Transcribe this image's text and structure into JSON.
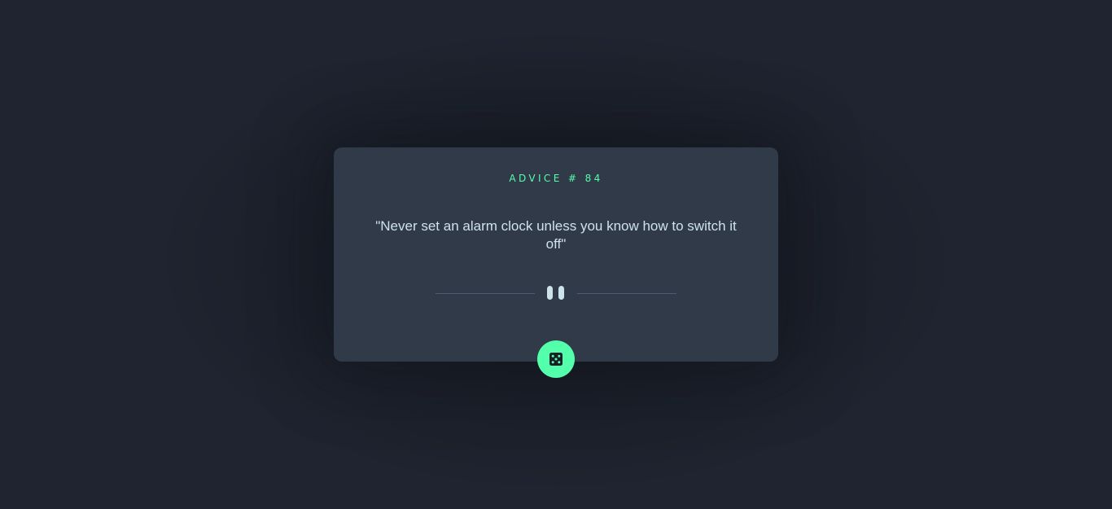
{
  "advice": {
    "heading": "ADVICE # 84",
    "text": "\"Never set an alarm clock unless you know how to switch it off\""
  },
  "divider": {
    "icon": "pause-icon"
  },
  "button": {
    "icon": "dice-icon",
    "aria_label": "Generate new advice"
  },
  "colors": {
    "background": "#1f2430",
    "card": "#313a49",
    "accent": "#53ffaa",
    "text": "#cee3e9",
    "divider_line": "#4f5d74"
  }
}
